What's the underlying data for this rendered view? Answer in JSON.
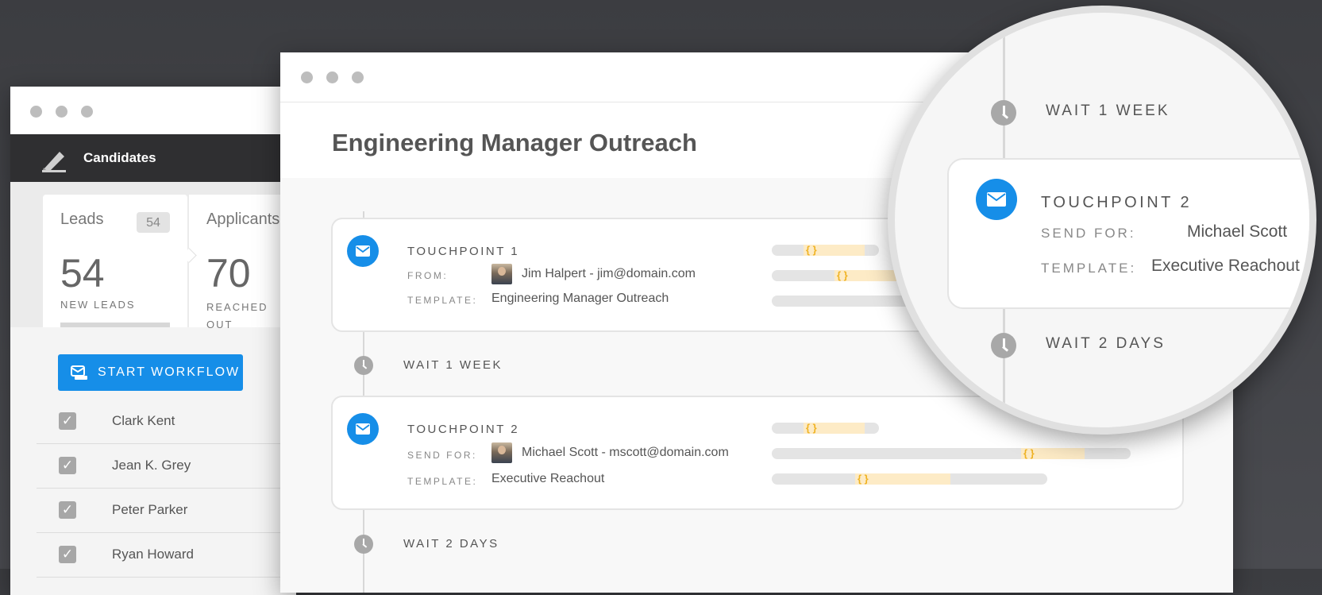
{
  "left_window": {
    "nav_title": "Candidates",
    "tabs": [
      {
        "label": "Leads",
        "badge": "54",
        "count": "54",
        "caption": "NEW LEADS"
      },
      {
        "label": "Applicants",
        "count": "70",
        "caption": "REACHED OUT"
      }
    ],
    "start_button": "START WORKFLOW",
    "candidates": [
      {
        "name": "Clark Kent",
        "checked": true
      },
      {
        "name": "Jean K. Grey",
        "checked": true
      },
      {
        "name": "Peter Parker",
        "checked": true
      },
      {
        "name": "Ryan Howard",
        "checked": true
      }
    ]
  },
  "main_window": {
    "title": "Engineering Manager Outreach",
    "touchpoint1": {
      "title": "TOUCHPOINT 1",
      "from_label": "FROM:",
      "from_value": "Jim Halpert - jim@domain.com",
      "template_label": "TEMPLATE:",
      "template_value": "Engineering Manager Outreach"
    },
    "wait1": "WAIT 1 WEEK",
    "touchpoint2": {
      "title": "TOUCHPOINT 2",
      "send_label": "SEND FOR:",
      "send_value": "Michael Scott - mscott@domain.com",
      "template_label": "TEMPLATE:",
      "template_value": "Executive Reachout"
    },
    "wait2": "WAIT 2 DAYS",
    "brace_text": "{ }"
  },
  "magnifier": {
    "wait1": "WAIT 1 WEEK",
    "touchpoint_title": "TOUCHPOINT 2",
    "send_label": "SEND FOR:",
    "send_value": "Michael Scott",
    "template_label": "TEMPLATE:",
    "template_value": "Executive Reachout",
    "wait2": "WAIT 2 DAYS"
  },
  "colors": {
    "accent": "#168ee8",
    "nav_bg": "#2f2f31",
    "brace_fill": "#fdebc6",
    "brace_text": "#f0b323",
    "backdrop": "#45464a"
  },
  "icons": [
    "pencil-logo-icon",
    "workflow-icon",
    "checkbox-icon",
    "envelope-icon",
    "clock-icon"
  ]
}
